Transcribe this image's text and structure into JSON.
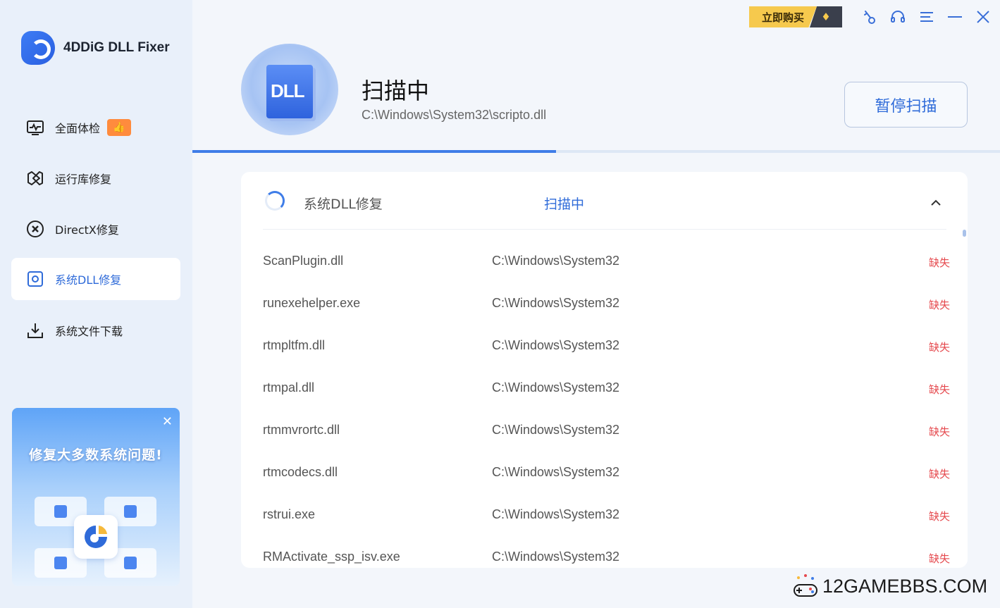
{
  "app": {
    "name": "4DDiG DLL Fixer"
  },
  "sidebar": {
    "items": [
      {
        "label": "全面体检",
        "icon": "health-check-icon",
        "badge": "👍"
      },
      {
        "label": "运行库修复",
        "icon": "runtime-icon"
      },
      {
        "label": "DirectX修复",
        "icon": "directx-icon"
      },
      {
        "label": "系统DLL修复",
        "icon": "dll-icon",
        "active": true
      },
      {
        "label": "系统文件下载",
        "icon": "download-icon"
      }
    ],
    "promo": {
      "title": "修复大多数系统问题!",
      "close": "✕"
    }
  },
  "topbar": {
    "buy_label": "立即购买",
    "gem": "♦",
    "icons": [
      "key-icon",
      "headset-icon",
      "menu-icon",
      "minimize-icon",
      "close-icon"
    ]
  },
  "header": {
    "art_label": "DLL",
    "status": "扫描中",
    "current_file": "C:\\Windows\\System32\\scripto.dll",
    "pause_button": "暂停扫描",
    "progress_percent": 45
  },
  "panel": {
    "title": "系统DLL修复",
    "status": "扫描中",
    "rows": [
      {
        "name": "ScanPlugin.dll",
        "path": "C:\\Windows\\System32",
        "state": "缺失"
      },
      {
        "name": "runexehelper.exe",
        "path": "C:\\Windows\\System32",
        "state": "缺失"
      },
      {
        "name": "rtmpltfm.dll",
        "path": "C:\\Windows\\System32",
        "state": "缺失"
      },
      {
        "name": "rtmpal.dll",
        "path": "C:\\Windows\\System32",
        "state": "缺失"
      },
      {
        "name": "rtmmvrortc.dll",
        "path": "C:\\Windows\\System32",
        "state": "缺失"
      },
      {
        "name": "rtmcodecs.dll",
        "path": "C:\\Windows\\System32",
        "state": "缺失"
      },
      {
        "name": "rstrui.exe",
        "path": "C:\\Windows\\System32",
        "state": "缺失"
      },
      {
        "name": "RMActivate_ssp_isv.exe",
        "path": "C:\\Windows\\System32",
        "state": "缺失"
      }
    ]
  },
  "watermark": {
    "text": "12GAMEBBS.COM"
  },
  "colors": {
    "accent": "#2f6bd9",
    "missing": "#e5484d",
    "sidebar_bg": "#e9f0fa",
    "buy_bg": "#f6c94d"
  }
}
